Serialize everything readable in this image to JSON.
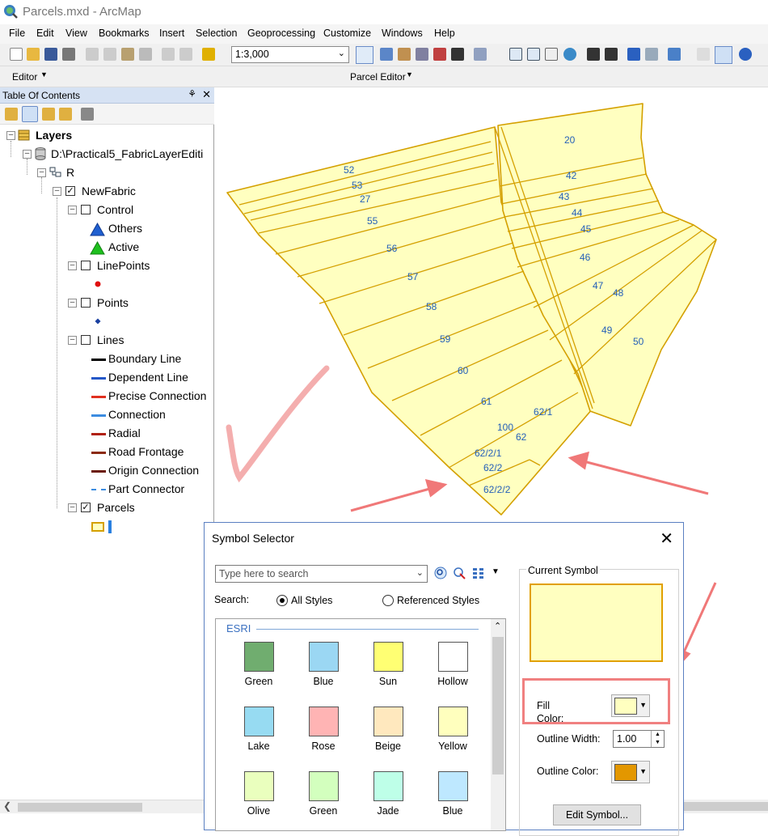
{
  "window": {
    "title": "Parcels.mxd - ArcMap"
  },
  "menu": [
    "File",
    "Edit",
    "View",
    "Bookmarks",
    "Insert",
    "Selection",
    "Geoprocessing",
    "Customize",
    "Windows",
    "Help"
  ],
  "toolbar": {
    "scale": "1:3,000",
    "editor_label": "Editor",
    "parcel_editor_label": "Parcel Editor"
  },
  "toc": {
    "title": "Table Of Contents",
    "root": "Layers",
    "fabric_path": "D:\\Practical5_FabricLayerEditi",
    "group": "R",
    "fabric": "NewFabric",
    "control": {
      "label": "Control",
      "items": [
        "Others",
        "Active"
      ]
    },
    "linepoints": "LinePoints",
    "points": "Points",
    "lines": {
      "label": "Lines",
      "items": [
        "Boundary Line",
        "Dependent Line",
        "Precise Connection",
        "Connection",
        "Radial",
        "Road Frontage",
        "Origin Connection",
        "Part Connector"
      ],
      "colors": [
        "#000000",
        "#2458c8",
        "#e03020",
        "#3c8ce0",
        "#b02010",
        "#8b2a10",
        "#6b1a08",
        "#3c8ce0"
      ]
    },
    "parcels": "Parcels"
  },
  "map": {
    "parcel_fill": "#ffffc0",
    "parcel_outline": "#d4a000",
    "label_color": "#2560b8",
    "labels": [
      "20",
      "42",
      "43",
      "44",
      "45",
      "46",
      "47",
      "48",
      "49",
      "50",
      "52",
      "53",
      "27",
      "55",
      "56",
      "57",
      "58",
      "59",
      "60",
      "61",
      "62/1",
      "100",
      "62",
      "62/2/1",
      "62/2",
      "62/2/2"
    ]
  },
  "dialog": {
    "title": "Symbol Selector",
    "search_placeholder": "Type here to search",
    "search_label": "Search:",
    "radio_all": "All Styles",
    "radio_ref": "Referenced Styles",
    "style_group": "ESRI",
    "swatches": [
      {
        "name": "Green",
        "color": "#70ad6f"
      },
      {
        "name": "Blue",
        "color": "#9bd7f3"
      },
      {
        "name": "Sun",
        "color": "#ffff73"
      },
      {
        "name": "Hollow",
        "color": "#ffffff"
      },
      {
        "name": "Lake",
        "color": "#97dbf2"
      },
      {
        "name": "Rose",
        "color": "#ffb4b4"
      },
      {
        "name": "Beige",
        "color": "#ffe8be"
      },
      {
        "name": "Yellow",
        "color": "#ffffbe"
      },
      {
        "name": "Olive",
        "color": "#eaffbe"
      },
      {
        "name": "Green",
        "color": "#d3ffbe"
      },
      {
        "name": "Jade",
        "color": "#beffe8"
      },
      {
        "name": "Blue",
        "color": "#bee8ff"
      }
    ],
    "current_symbol_label": "Current Symbol",
    "fill_color_label": "Fill\nColor:",
    "fill_color": "#ffffc0",
    "outline_width_label": "Outline Width:",
    "outline_width": "1.00",
    "outline_color_label": "Outline Color:",
    "outline_color": "#e39700",
    "edit_symbol": "Edit Symbol..."
  }
}
